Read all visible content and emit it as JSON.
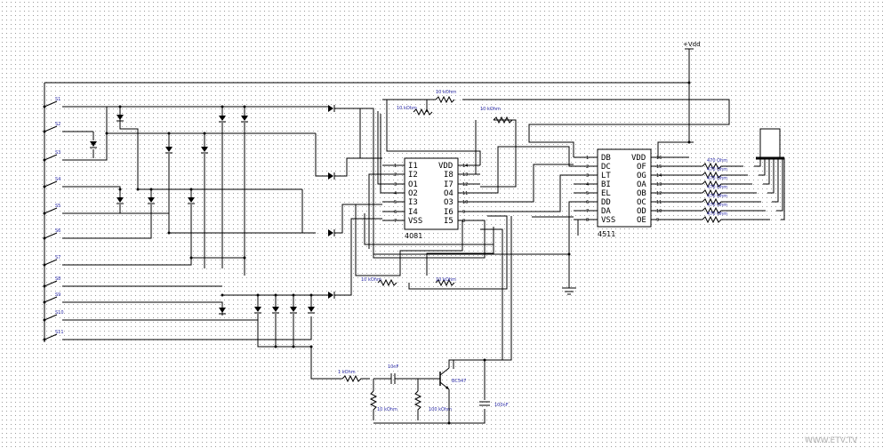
{
  "supply": {
    "label": "+Vdd"
  },
  "switches": {
    "labels": [
      "S1",
      "S2",
      "S3",
      "S4",
      "S5",
      "S6",
      "S7",
      "S8",
      "S9",
      "S10",
      "S11"
    ]
  },
  "ic_4081": {
    "name": "4081",
    "left_pins": [
      "I1",
      "I2",
      "O1",
      "O2",
      "I3",
      "I4",
      "VSS"
    ],
    "left_nums": [
      "1",
      "2",
      "3",
      "4",
      "5",
      "6",
      "7"
    ],
    "right_pins": [
      "VDD",
      "I8",
      "I7",
      "O4",
      "O3",
      "I6",
      "I5"
    ],
    "right_nums": [
      "14",
      "13",
      "12",
      "11",
      "10",
      "9",
      "8"
    ]
  },
  "ic_4511": {
    "name": "4511",
    "left_pins": [
      "DB",
      "DC",
      "LT",
      "BI",
      "EL",
      "DD",
      "DA",
      "VSS"
    ],
    "left_nums": [
      "1",
      "2",
      "3",
      "4",
      "5",
      "6",
      "7",
      "8"
    ],
    "right_pins": [
      "VDD",
      "OF",
      "OG",
      "OA",
      "OB",
      "OC",
      "OD",
      "OE"
    ],
    "right_nums": [
      "16",
      "15",
      "14",
      "13",
      "12",
      "11",
      "10",
      "9"
    ]
  },
  "resistors": {
    "r_top": "10 kOhm",
    "r_a": "10 kOhm",
    "r_b": "10 kOhm",
    "r_c": "10 kOhm",
    "r_d": "10 kOhm",
    "seg": [
      "470 Ohm",
      "470 Ohm",
      "470 Ohm",
      "470 Ohm",
      "470 Ohm",
      "470 Ohm",
      "470 Ohm"
    ],
    "r_osc1": "1 kOhm",
    "r_osc2": "10 kOhm",
    "r_osc3": "100 kOhm"
  },
  "capacitors": {
    "c1": "10nF",
    "c2": "100nF"
  },
  "transistor": {
    "label": "BC547"
  },
  "watermark": "WWW.ETV.TV"
}
